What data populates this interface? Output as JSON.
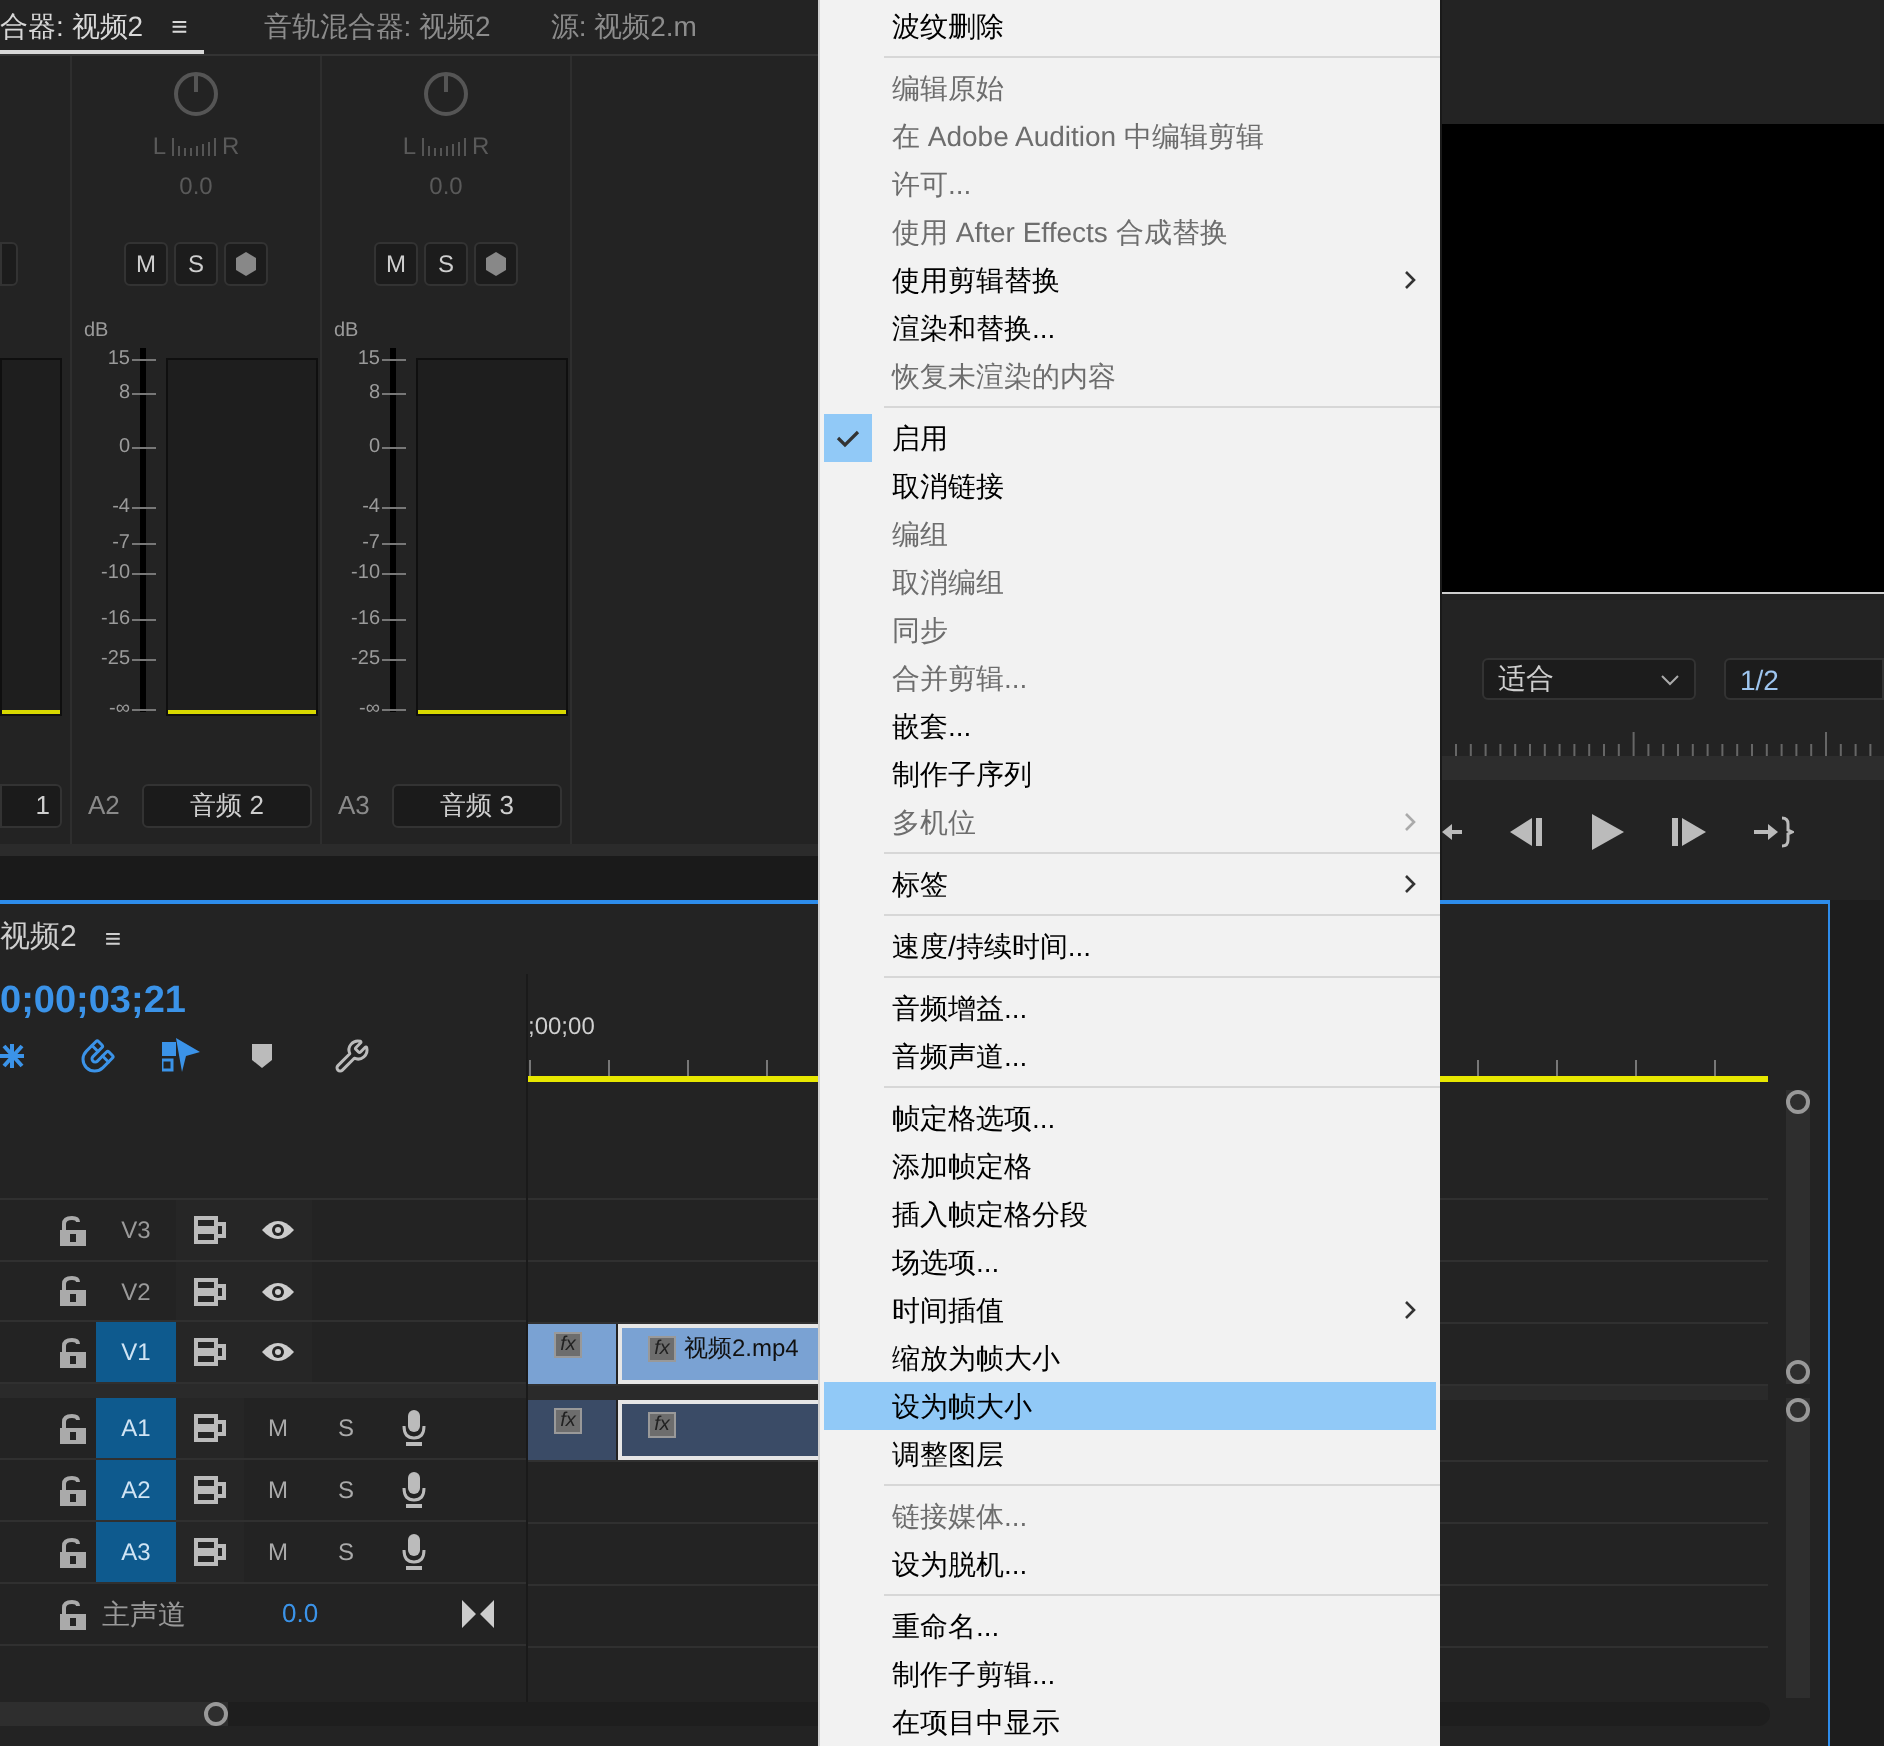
{
  "mixer": {
    "tabs": [
      {
        "label": "合器: 视频2",
        "selected": true,
        "menu": "≡"
      },
      {
        "label": "音轨混合器: 视频2",
        "selected": false
      },
      {
        "label": "源: 视频2.m",
        "selected": false
      }
    ],
    "channels": [
      {
        "kind": "clipped",
        "name": "1",
        "level": 0
      },
      {
        "kind": "full",
        "pan_left": "L",
        "pan_right": "R",
        "pan_value": "0.0",
        "mute": "M",
        "solo": "S",
        "unit": "dB",
        "scale": [
          "15",
          "8",
          "0",
          "-4",
          "-7",
          "-10",
          "-16",
          "-25",
          "-∞"
        ],
        "level": 0,
        "track": "A2",
        "name": "音频 2"
      },
      {
        "kind": "full",
        "pan_left": "L",
        "pan_right": "R",
        "pan_value": "0.0",
        "mute": "M",
        "solo": "S",
        "unit": "dB",
        "scale": [
          "15",
          "8",
          "0",
          "-4",
          "-7",
          "-10",
          "-16",
          "-25",
          "-∞"
        ],
        "level": 0,
        "track": "A3",
        "name": "音频 3"
      }
    ]
  },
  "monitor": {
    "zoom": "适合",
    "resolution": "1/2"
  },
  "timeline": {
    "tab": "视频2",
    "menu": "≡",
    "timecode": "0;00;03;21",
    "ruler_start": ";00;00",
    "tracks": [
      {
        "kind": "video",
        "label": "V3",
        "targeted": false
      },
      {
        "kind": "video",
        "label": "V2",
        "targeted": false
      },
      {
        "kind": "video",
        "label": "V1",
        "targeted": true,
        "clips": [
          {
            "selected": false,
            "badge": "fx"
          },
          {
            "selected": true,
            "badge": "fx",
            "name": "视频2.mp4"
          }
        ]
      },
      {
        "kind": "audio",
        "label": "A1",
        "targeted": true,
        "mute": "M",
        "solo": "S",
        "clips": [
          {
            "selected": false,
            "badge": "fx"
          },
          {
            "selected": true,
            "badge": "fx"
          }
        ]
      },
      {
        "kind": "audio",
        "label": "A2",
        "targeted": true,
        "mute": "M",
        "solo": "S"
      },
      {
        "kind": "audio",
        "label": "A3",
        "targeted": true,
        "mute": "M",
        "solo": "S"
      }
    ],
    "master": {
      "label": "主声道",
      "value": "0.0"
    }
  },
  "menu": {
    "items": [
      {
        "kind": "item",
        "label": "波纹删除",
        "disabled": false,
        "checked": false,
        "selected": false,
        "submenu": false
      },
      {
        "kind": "separator"
      },
      {
        "kind": "item",
        "label": "编辑原始",
        "disabled": true,
        "checked": false,
        "selected": false,
        "submenu": false
      },
      {
        "kind": "item",
        "label": "在 Adobe Audition 中编辑剪辑",
        "disabled": true,
        "checked": false,
        "selected": false,
        "submenu": false
      },
      {
        "kind": "item",
        "label": "许可...",
        "disabled": true,
        "checked": false,
        "selected": false,
        "submenu": false
      },
      {
        "kind": "item",
        "label": "使用 After Effects 合成替换",
        "disabled": true,
        "checked": false,
        "selected": false,
        "submenu": false
      },
      {
        "kind": "item",
        "label": "使用剪辑替换",
        "disabled": false,
        "checked": false,
        "selected": false,
        "submenu": true
      },
      {
        "kind": "item",
        "label": "渲染和替换...",
        "disabled": false,
        "checked": false,
        "selected": false,
        "submenu": false
      },
      {
        "kind": "item",
        "label": "恢复未渲染的内容",
        "disabled": true,
        "checked": false,
        "selected": false,
        "submenu": false
      },
      {
        "kind": "separator"
      },
      {
        "kind": "item",
        "label": "启用",
        "disabled": false,
        "checked": true,
        "selected": false,
        "submenu": false
      },
      {
        "kind": "item",
        "label": "取消链接",
        "disabled": false,
        "checked": false,
        "selected": false,
        "submenu": false
      },
      {
        "kind": "item",
        "label": "编组",
        "disabled": true,
        "checked": false,
        "selected": false,
        "submenu": false
      },
      {
        "kind": "item",
        "label": "取消编组",
        "disabled": true,
        "checked": false,
        "selected": false,
        "submenu": false
      },
      {
        "kind": "item",
        "label": "同步",
        "disabled": true,
        "checked": false,
        "selected": false,
        "submenu": false
      },
      {
        "kind": "item",
        "label": "合并剪辑...",
        "disabled": true,
        "checked": false,
        "selected": false,
        "submenu": false
      },
      {
        "kind": "item",
        "label": "嵌套...",
        "disabled": false,
        "checked": false,
        "selected": false,
        "submenu": false
      },
      {
        "kind": "item",
        "label": "制作子序列",
        "disabled": false,
        "checked": false,
        "selected": false,
        "submenu": false
      },
      {
        "kind": "item",
        "label": "多机位",
        "disabled": true,
        "checked": false,
        "selected": false,
        "submenu": true
      },
      {
        "kind": "separator"
      },
      {
        "kind": "item",
        "label": "标签",
        "disabled": false,
        "checked": false,
        "selected": false,
        "submenu": true
      },
      {
        "kind": "separator"
      },
      {
        "kind": "item",
        "label": "速度/持续时间...",
        "disabled": false,
        "checked": false,
        "selected": false,
        "submenu": false
      },
      {
        "kind": "separator"
      },
      {
        "kind": "item",
        "label": "音频增益...",
        "disabled": false,
        "checked": false,
        "selected": false,
        "submenu": false
      },
      {
        "kind": "item",
        "label": "音频声道...",
        "disabled": false,
        "checked": false,
        "selected": false,
        "submenu": false
      },
      {
        "kind": "separator"
      },
      {
        "kind": "item",
        "label": "帧定格选项...",
        "disabled": false,
        "checked": false,
        "selected": false,
        "submenu": false
      },
      {
        "kind": "item",
        "label": "添加帧定格",
        "disabled": false,
        "checked": false,
        "selected": false,
        "submenu": false
      },
      {
        "kind": "item",
        "label": "插入帧定格分段",
        "disabled": false,
        "checked": false,
        "selected": false,
        "submenu": false
      },
      {
        "kind": "item",
        "label": "场选项...",
        "disabled": false,
        "checked": false,
        "selected": false,
        "submenu": false
      },
      {
        "kind": "item",
        "label": "时间插值",
        "disabled": false,
        "checked": false,
        "selected": false,
        "submenu": true
      },
      {
        "kind": "item",
        "label": "缩放为帧大小",
        "disabled": false,
        "checked": false,
        "selected": false,
        "submenu": false
      },
      {
        "kind": "item",
        "label": "设为帧大小",
        "disabled": false,
        "checked": false,
        "selected": true,
        "submenu": false
      },
      {
        "kind": "item",
        "label": "调整图层",
        "disabled": false,
        "checked": false,
        "selected": false,
        "submenu": false
      },
      {
        "kind": "separator"
      },
      {
        "kind": "item",
        "label": "链接媒体...",
        "disabled": true,
        "checked": false,
        "selected": false,
        "submenu": false
      },
      {
        "kind": "item",
        "label": "设为脱机...",
        "disabled": false,
        "checked": false,
        "selected": false,
        "submenu": false
      },
      {
        "kind": "separator"
      },
      {
        "kind": "item",
        "label": "重命名...",
        "disabled": false,
        "checked": false,
        "selected": false,
        "submenu": false
      },
      {
        "kind": "item",
        "label": "制作子剪辑...",
        "disabled": false,
        "checked": false,
        "selected": false,
        "submenu": false
      },
      {
        "kind": "item",
        "label": "在项目中显示",
        "disabled": false,
        "checked": false,
        "selected": false,
        "submenu": false
      }
    ]
  }
}
